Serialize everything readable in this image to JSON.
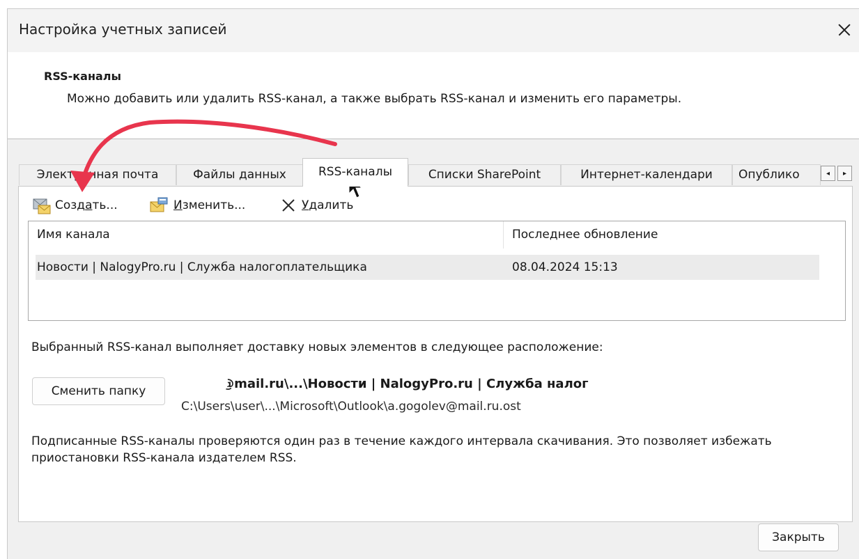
{
  "window": {
    "title": "Настройка учетных записей"
  },
  "header": {
    "title": "RSS-каналы",
    "description": "Можно добавить или удалить RSS-канал, а также выбрать RSS-канал и изменить его параметры."
  },
  "tabs": [
    {
      "label": "Электронная почта"
    },
    {
      "label": "Файлы данных"
    },
    {
      "label": "RSS-каналы",
      "active": true
    },
    {
      "label": "Списки SharePoint"
    },
    {
      "label": "Интернет-календари"
    },
    {
      "label": "Опублико"
    }
  ],
  "toolbar": {
    "create": {
      "pre": "Созд",
      "accel": "а",
      "post": "ть..."
    },
    "edit": {
      "pre": "",
      "accel": "И",
      "post": "зменить..."
    },
    "delete": {
      "pre": "",
      "accel": "У",
      "post": "далить"
    }
  },
  "feed_table": {
    "columns": [
      "Имя канала",
      "Последнее обновление"
    ],
    "rows": [
      {
        "name": "Новости | NalogyPro.ru | Служба налогоплательщика",
        "updated": "08.04.2024 15:13"
      }
    ]
  },
  "delivery": {
    "text": "Выбранный RSS-канал выполняет доставку новых элементов в следующее расположение:",
    "change_folder_label": "Сменить папку",
    "folder_path": "g   ev@mail.ru\\...\\Новости | NalogyPro.ru | Служба налог",
    "file_path": "C:\\Users\\user\\...\\Microsoft\\Outlook\\a.gogolev@mail.ru.ost"
  },
  "note": "Подписанные RSS-каналы проверяются один раз в течение каждого интервала скачивания. Это позволяет избежать приостановки RSS-канала издателем RSS.",
  "footer": {
    "close_label": "Закрыть"
  },
  "colors": {
    "annotation_arrow": "#e8354d",
    "body_bg": "#f0f0f0",
    "selected_row": "#ebebeb"
  },
  "icons": [
    "close-icon",
    "new-feed-envelope-icon",
    "edit-feed-icon",
    "delete-x-icon",
    "scroll-left-icon",
    "scroll-right-icon",
    "mouse-cursor-icon"
  ]
}
